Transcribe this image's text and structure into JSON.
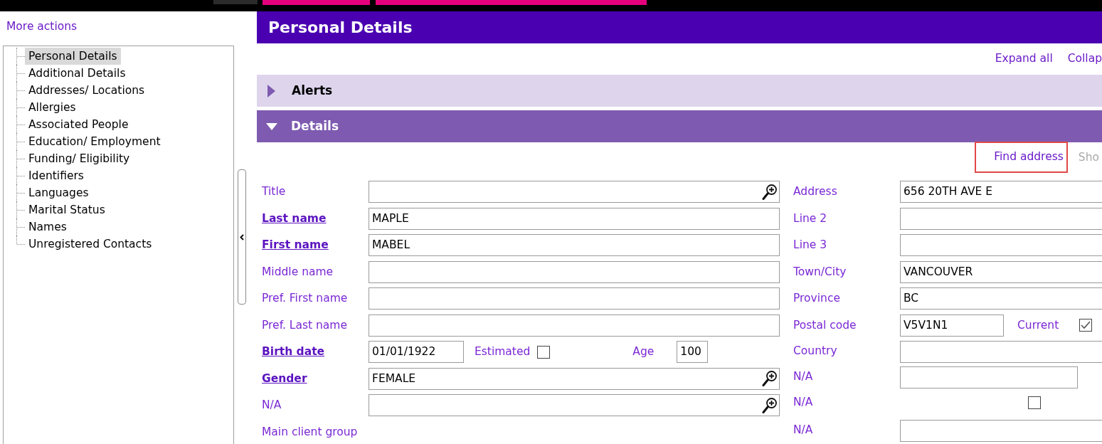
{
  "top_bar": {
    "tabs": [
      {
        "color": "#2b2b2b"
      },
      {
        "color": "#e5007d"
      },
      {
        "color": "#e5007d"
      }
    ]
  },
  "sidebar": {
    "more_actions": "More actions",
    "tree": [
      {
        "label": "Personal Details",
        "selected": true
      },
      {
        "label": "Additional Details",
        "selected": false
      },
      {
        "label": "Addresses/ Locations",
        "selected": false
      },
      {
        "label": "Allergies",
        "selected": false
      },
      {
        "label": "Associated People",
        "selected": false
      },
      {
        "label": "Education/ Employment",
        "selected": false
      },
      {
        "label": "Funding/ Eligibility",
        "selected": false
      },
      {
        "label": "Identifiers",
        "selected": false
      },
      {
        "label": "Languages",
        "selected": false
      },
      {
        "label": "Marital Status",
        "selected": false
      },
      {
        "label": "Names",
        "selected": false
      },
      {
        "label": "Unregistered Contacts",
        "selected": false
      }
    ]
  },
  "page": {
    "title": "Personal Details",
    "links": [
      "Expand all",
      "Collap"
    ]
  },
  "sections": [
    {
      "title": "Alerts",
      "expanded": false
    },
    {
      "title": "Details",
      "expanded": true
    }
  ],
  "details": {
    "actions": [
      {
        "label": "Find address",
        "highlighted": true,
        "disabled": false
      },
      {
        "label": "Sho",
        "highlighted": false,
        "disabled": true
      }
    ],
    "left_fields": [
      {
        "kind": "text",
        "label": "Title",
        "required": false,
        "lookup": true
      },
      {
        "kind": "text",
        "label": "Last name",
        "required": true,
        "lookup": false,
        "value": "MAPLE"
      },
      {
        "kind": "text",
        "label": "First name",
        "required": true,
        "lookup": false,
        "value": "MABEL"
      },
      {
        "kind": "text",
        "label": "Middle name",
        "required": false,
        "lookup": false
      },
      {
        "kind": "text",
        "label": "Pref. First name",
        "required": false,
        "lookup": false
      },
      {
        "kind": "text",
        "label": "Pref. Last name",
        "required": false,
        "lookup": false
      },
      {
        "kind": "date",
        "label": "Birth date",
        "required": true,
        "value": "01/01/1922",
        "estimated": {
          "label": "Estimated",
          "checked": false
        },
        "age": {
          "label": "Age",
          "value": "100"
        }
      },
      {
        "kind": "text",
        "label": "Gender",
        "required": true,
        "lookup": true,
        "value": "FEMALE"
      },
      {
        "kind": "text",
        "label": "N/A",
        "required": false,
        "lookup": true
      },
      {
        "kind": "label",
        "label": "Main client group",
        "required": false
      }
    ],
    "right_fields": [
      {
        "kind": "text",
        "label": "Address",
        "required": false,
        "value": "656 20TH AVE E"
      },
      {
        "kind": "text",
        "label": "Line 2",
        "required": false
      },
      {
        "kind": "text",
        "label": "Line 3",
        "required": false
      },
      {
        "kind": "text",
        "label": "Town/City",
        "required": false,
        "value": "VANCOUVER"
      },
      {
        "kind": "text",
        "label": "Province",
        "required": false,
        "value": "BC"
      },
      {
        "kind": "postal",
        "label": "Postal code",
        "required": false,
        "value": "V5V1N1",
        "current": {
          "label": "Current",
          "checked": true
        }
      },
      {
        "kind": "text",
        "label": "Country",
        "required": false
      },
      {
        "kind": "short",
        "label": "N/A",
        "required": false
      },
      {
        "kind": "checkbox",
        "label": "N/A",
        "required": false,
        "checked": false
      },
      {
        "kind": "text",
        "label": "N/A",
        "required": false
      }
    ]
  }
}
